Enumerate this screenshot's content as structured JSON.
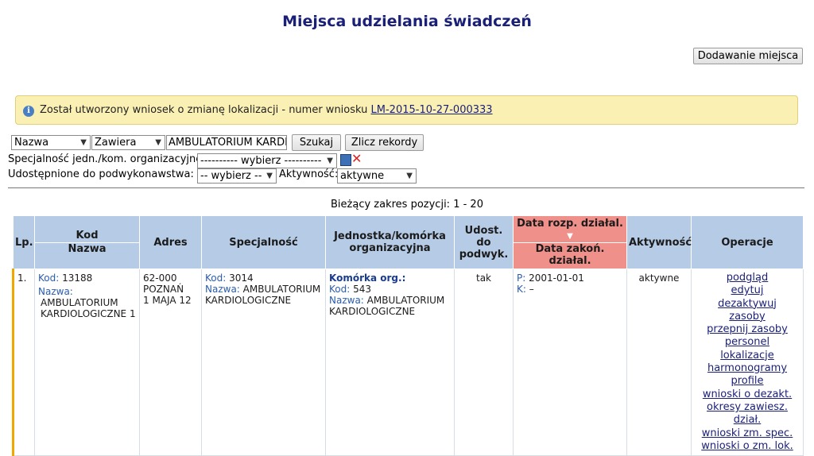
{
  "page_title": "Miejsca udzielania świadczeń",
  "add_button": "Dodawanie miejsca",
  "notice": {
    "icon": "info-icon",
    "text": "Został utworzony wniosek o zmianę lokalizacji - numer wniosku",
    "link": "LM-2015-10-27-000333"
  },
  "filters": {
    "field_select": "Nazwa",
    "operator_select": "Zawiera",
    "search_value": "AMBULATORIUM KARDIOL",
    "search_button": "Szukaj",
    "count_button": "Zlicz rekordy",
    "specialty_label": "Specjalność jedn./kom. organizacyjnej:",
    "specialty_select": "---------- wybierz ----------",
    "subcontract_label": "Udostępnione do podwykonawstwa:",
    "subcontract_select": "-- wybierz --",
    "activity_label": "Aktywność:",
    "activity_select": "aktywne"
  },
  "range_text": "Bieżący zakres pozycji: 1 - 20",
  "table": {
    "headers": {
      "lp": "Lp.",
      "kod": "Kod",
      "nazwa": "Nazwa",
      "adres": "Adres",
      "specjalnosc": "Specjalność",
      "jednostka": "Jednostka/komórka organizacyjna",
      "udost": "Udost. do podwyk.",
      "data_rozp": "Data rozp. działal.",
      "data_zak": "Data zakoń. działal.",
      "aktywnosc": "Aktywność",
      "operacje": "Operacje"
    },
    "rows": [
      {
        "lp": "1.",
        "kod_label": "Kod:",
        "kod": "13188",
        "nazwa_label": "Nazwa:",
        "nazwa": "AMBULATORIUM KARDIOLOGICZNE 1",
        "adres_line1": "62-000",
        "adres_line2": "POZNAŃ",
        "adres_line3": "1 MAJA 12",
        "spec_kod_label": "Kod:",
        "spec_kod": "3014",
        "spec_nazwa_label": "Nazwa:",
        "spec_nazwa": "AMBULATORIUM KARDIOLOGICZNE",
        "jedn_title": "Komórka org.:",
        "jedn_kod_label": "Kod:",
        "jedn_kod": "543",
        "jedn_nazwa_label": "Nazwa:",
        "jedn_nazwa": "AMBULATORIUM KARDIOLOGICZNE",
        "udost": "tak",
        "p_label": "P:",
        "p_value": "2001-01-01",
        "k_label": "K:",
        "k_value": "–",
        "aktywnosc": "aktywne",
        "operations": [
          "podgląd",
          "edytuj",
          "dezaktywuj",
          "zasoby",
          "przepnij zasoby",
          "personel",
          "lokalizacje",
          "harmonogramy",
          "profile",
          "wnioski o dezakt.",
          "okresy zawiesz. dział.",
          "wnioski zm. spec.",
          "wnioski o zm. lok."
        ]
      }
    ]
  },
  "colors": {
    "title": "#1a1f78",
    "header_bg": "#b5cbe6",
    "sorted_header_bg": "#f0908a",
    "notice_bg": "#fbf0b4",
    "row_marker": "#f0a800"
  }
}
